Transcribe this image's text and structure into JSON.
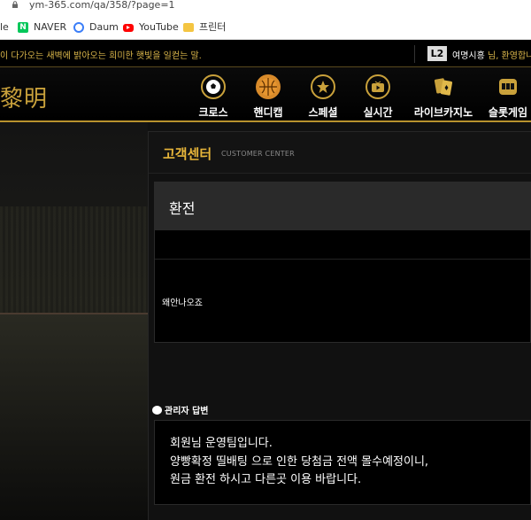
{
  "browser": {
    "url": "ym-365.com/qa/358/?page=1",
    "bookmarks": [
      {
        "label": "le",
        "icon": "none"
      },
      {
        "label": "NAVER",
        "icon": "naver-icon",
        "color": "#03c75a"
      },
      {
        "label": "Daum",
        "icon": "daum-icon",
        "color": "#3b7ef8"
      },
      {
        "label": "YouTube",
        "icon": "youtube-icon",
        "color": "#ff0000"
      },
      {
        "label": "프린터",
        "icon": "folder-icon",
        "color": "#f4c542"
      }
    ]
  },
  "notice": {
    "message": "이 다가오는 새벽에 밝아오는 희미한 햇빛을 일컫는 말.",
    "level_badge": "L2",
    "user_name": "여명시흥",
    "greeting": " 님, 환영합니"
  },
  "header": {
    "logo_text": "黎明",
    "nav": [
      {
        "label": "크로스",
        "icon": "soccer-ball-icon"
      },
      {
        "label": "핸디캡",
        "icon": "basketball-icon"
      },
      {
        "label": "스페셜",
        "icon": "star-icon"
      },
      {
        "label": "실시간",
        "icon": "live-tv-icon"
      },
      {
        "label": "라이브카지노",
        "icon": "cards-icon"
      },
      {
        "label": "슬롯게임",
        "icon": "slot-machine-icon"
      }
    ]
  },
  "customer_center": {
    "title": "고객센터",
    "subtitle": "CUSTOMER CENTER"
  },
  "post": {
    "subject": "환전",
    "body": "왜안나오죠"
  },
  "reply": {
    "label": "관리자 답변",
    "lines": [
      "회원님 운영팀입니다.",
      "양빵확정 띨배팅 으로 인한 당첨금 전액 몰수예정이니,",
      "원금 환전 하시고 다른곳 이용 바랍니다."
    ]
  },
  "colors": {
    "accent": "#e8b63a",
    "gold": "#c9a13b",
    "notice_text": "#d9b54a"
  }
}
